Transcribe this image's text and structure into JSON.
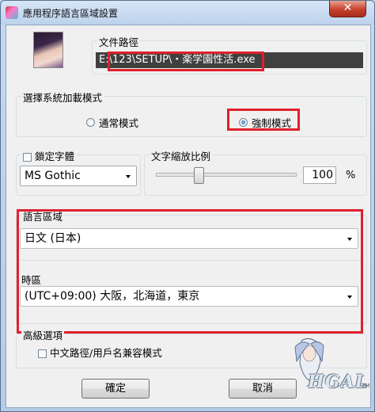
{
  "window": {
    "title": "應用程序語言區域設置",
    "close_glyph": "✕",
    "icon": "app-icon"
  },
  "file_path": {
    "label": "文件路徑",
    "value": "E:\\123\\SETUP\\・楽学園性活.exe"
  },
  "load_mode": {
    "label": "選擇系統加載模式",
    "options": [
      {
        "label": "通常模式",
        "selected": false
      },
      {
        "label": "強制模式",
        "selected": true
      }
    ]
  },
  "font": {
    "lock_label": "鎖定字體",
    "locked": false,
    "selected": "MS Gothic"
  },
  "scale": {
    "label": "文字縮放比例",
    "value": "100",
    "unit": "%",
    "slider_fraction": 0.3
  },
  "language": {
    "label": "語言區域",
    "selected": "日文 (日本)"
  },
  "timezone": {
    "label": "時區",
    "selected": "(UTC+09:00) 大阪，北海道，東京"
  },
  "advanced": {
    "label": "高級選項",
    "compat_label": "中文路徑/用戶名兼容模式",
    "compat_checked": false
  },
  "buttons": {
    "ok": "確定",
    "cancel": "取消"
  },
  "watermark": {
    "main": "HGAL",
    "small": "TM"
  },
  "colors": {
    "highlight": "#e0202c",
    "title_bg": "#c5d9ef"
  }
}
